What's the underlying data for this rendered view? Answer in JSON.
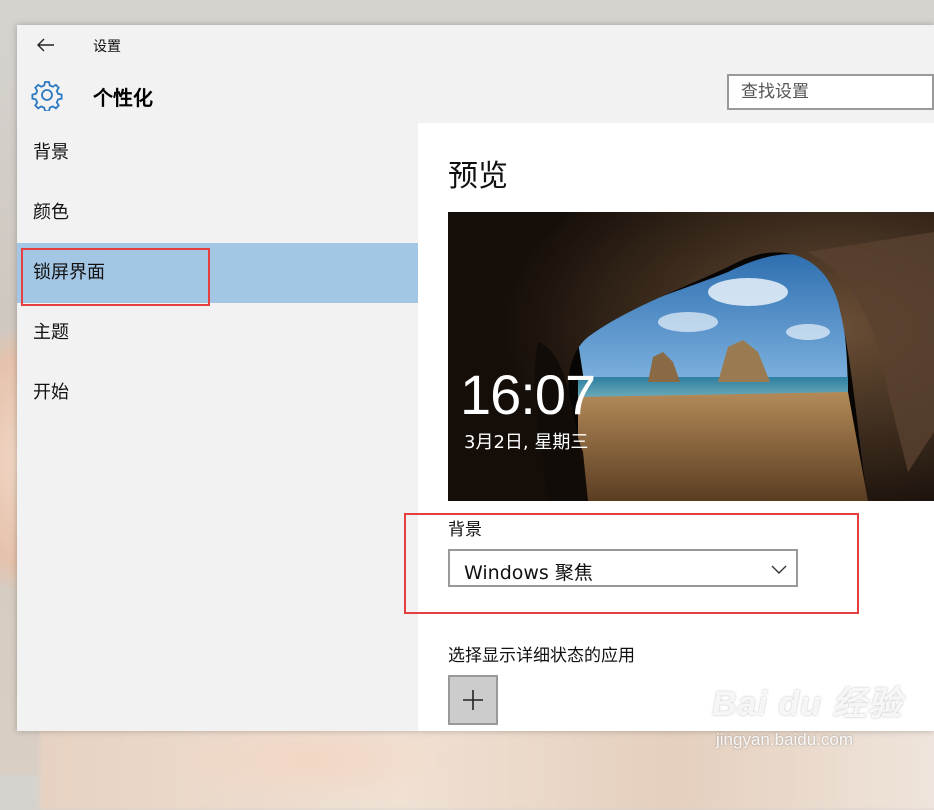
{
  "window": {
    "title": "设置",
    "page_title": "个性化"
  },
  "search": {
    "placeholder": "查找设置"
  },
  "sidebar": {
    "items": [
      {
        "label": "背景",
        "active": false
      },
      {
        "label": "颜色",
        "active": false
      },
      {
        "label": "锁屏界面",
        "active": true
      },
      {
        "label": "主题",
        "active": false
      },
      {
        "label": "开始",
        "active": false
      }
    ]
  },
  "main": {
    "preview_title": "预览",
    "lock_screen": {
      "time": "16:07",
      "date": "3月2日, 星期三"
    },
    "background": {
      "label": "背景",
      "selected": "Windows 聚焦"
    },
    "apps_label": "选择显示详细状态的应用"
  },
  "watermark": {
    "logo": "Bai du 经验",
    "url": "jingyan.baidu.com"
  },
  "colors": {
    "accent": "#a4c6e5",
    "highlight_box": "#e5403f",
    "gear_icon": "#2b79c2"
  }
}
